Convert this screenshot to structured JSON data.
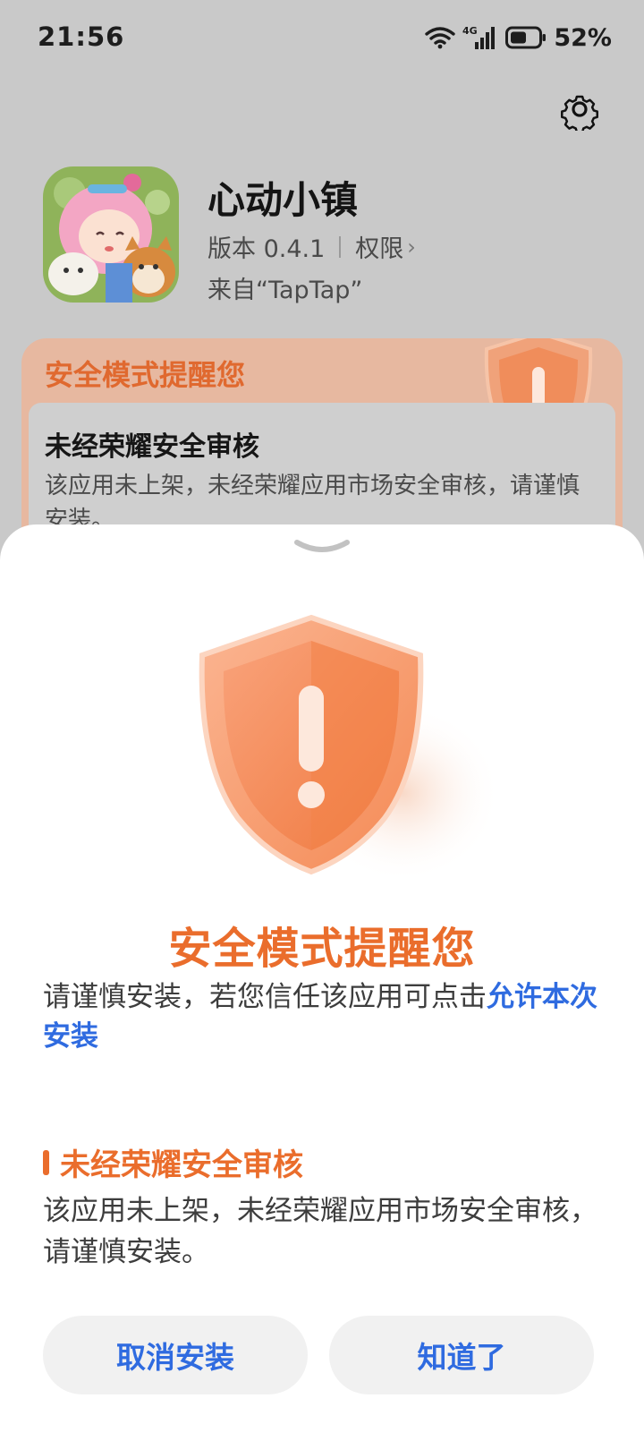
{
  "status_bar": {
    "time": "21:56",
    "network": "4G",
    "battery": "52%",
    "icons": [
      "wifi-icon",
      "cellular-signal-icon",
      "battery-icon"
    ]
  },
  "header": {
    "settings_icon": "gear-icon"
  },
  "app": {
    "name": "心动小镇",
    "version": "版本 0.4.1",
    "permissions": "权限",
    "permissions_chevron": "›",
    "source": "来自“TapTap”"
  },
  "background_card": {
    "title": "安全模式提醒您",
    "subtitle": "未经荣耀安全审核",
    "description": "该应用未上架，未经荣耀应用市场安全审核，请谨慎安装。"
  },
  "sheet": {
    "title": "安全模式提醒您",
    "description_prefix": "请谨慎安装，若您信任该应用可点击",
    "description_link": "允许本次安装",
    "section_title": "未经荣耀安全审核",
    "section_description": "该应用未上架，未经荣耀应用市场安全审核，请谨慎安装。",
    "cancel_button": "取消安装",
    "ok_button": "知道了"
  },
  "colors": {
    "accent_orange": "#ea6d2c",
    "link_blue": "#2f6be0",
    "button_bg": "#f1f1f1"
  }
}
